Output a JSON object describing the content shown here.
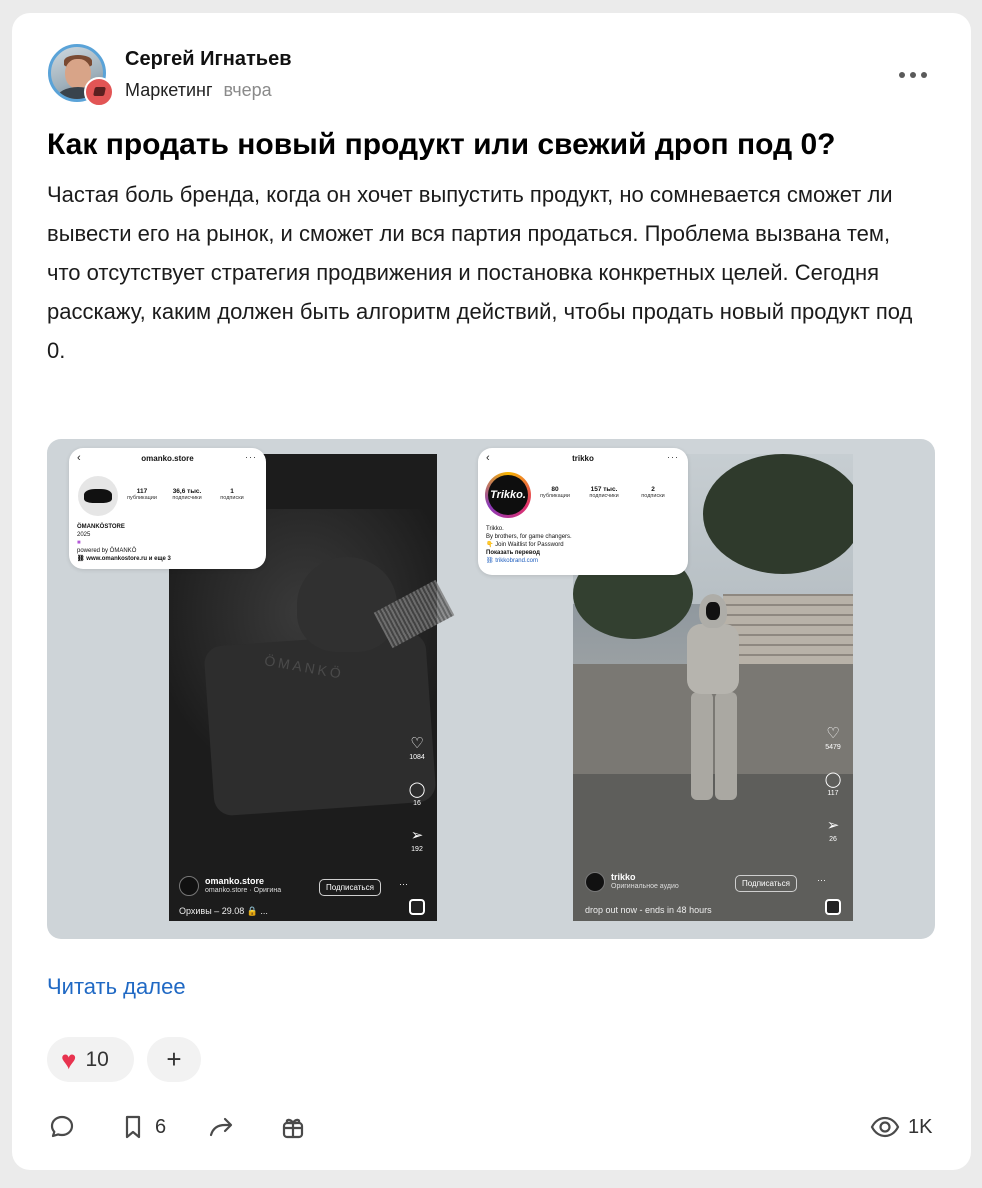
{
  "post": {
    "author": "Сергей Игнатьев",
    "category": "Маркетинг",
    "time": "вчера",
    "title": "Как продать новый продукт или свежий дроп под 0?",
    "body": "Частая боль бренда, когда он хочет выпустить продукт, но сомневается сможет ли вывести его на рынок, и сможет ли вся партия продаться. Проблема вызвана тем, что отсутствует стратегия продвижения и постановка конкретных целей. Сегодня расскажу, каким должен быть алгоритм действий, чтобы продать новый продукт под 0.",
    "read_more": "Читать далее"
  },
  "reactions": {
    "like_icon": "heart-icon",
    "like_count": "10",
    "add_label": "+"
  },
  "actions": {
    "comment_icon": "comment-icon",
    "bookmark_icon": "bookmark-icon",
    "bookmark_count": "6",
    "share_icon": "share-arrow-icon",
    "gift_icon": "gift-icon",
    "views_icon": "eye-icon",
    "views_count": "1K"
  },
  "screenshot_left": {
    "username": "omanko.store",
    "stats": [
      {
        "n": "117",
        "l": "публикации"
      },
      {
        "n": "36,6 тыс.",
        "l": "подписчики"
      },
      {
        "n": "1",
        "l": "подписки"
      }
    ],
    "bio": [
      "ÖMANKÖSTORE",
      "2025",
      "powered by ÖMANKÖ"
    ],
    "link": "www.omankostore.ru и еще 3",
    "hoodie_text": "ÖMANKÖ",
    "likes": "1084",
    "comments": "16",
    "shares": "192",
    "account": "omanko.store",
    "audio": "omanko.store · Оригина",
    "subscribe": "Подписаться",
    "caption": "Орхивы – 29.08 🔒 ..."
  },
  "screenshot_right": {
    "username": "trikko",
    "logo": "Trikko.",
    "stats": [
      {
        "n": "80",
        "l": "публикации"
      },
      {
        "n": "157 тыс.",
        "l": "подписчики"
      },
      {
        "n": "2",
        "l": "подписки"
      }
    ],
    "bio": [
      "Trikko.",
      "By brothers, for game changers.",
      "👇 Join Waitlist for Password"
    ],
    "translate": "Показать перевод",
    "link": "trikkobrand.com",
    "likes": "5479",
    "comments": "117",
    "shares": "26",
    "account": "trikko",
    "audio": "Оригинальное аудио",
    "subscribe": "Подписаться",
    "caption": "drop out now - ends in 48 hours"
  },
  "colors": {
    "link": "#2069c4",
    "like": "#e8334f",
    "background": "#ebebeb"
  }
}
